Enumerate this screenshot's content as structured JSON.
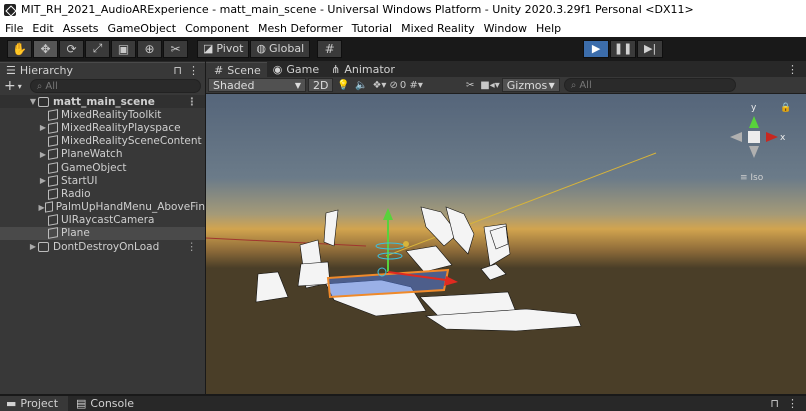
{
  "window": {
    "title": "MIT_RH_2021_AudioARExperience - matt_main_scene - Universal Windows Platform - Unity 2020.3.29f1 Personal <DX11>"
  },
  "menu": [
    "File",
    "Edit",
    "Assets",
    "GameObject",
    "Component",
    "Mesh Deformer",
    "Tutorial",
    "Mixed Reality",
    "Window",
    "Help"
  ],
  "toolbar": {
    "pivot": "Pivot",
    "global": "Global"
  },
  "hierarchy": {
    "tab": "Hierarchy",
    "search_placeholder": "All",
    "add_label": "+",
    "scene": "matt_main_scene",
    "items": [
      {
        "label": "MixedRealityToolkit",
        "expandable": false
      },
      {
        "label": "MixedRealityPlayspace",
        "expandable": true
      },
      {
        "label": "MixedRealitySceneContent",
        "expandable": false
      },
      {
        "label": "PlaneWatch",
        "expandable": true
      },
      {
        "label": "GameObject",
        "expandable": false
      },
      {
        "label": "StartUI",
        "expandable": true
      },
      {
        "label": "Radio",
        "expandable": false
      },
      {
        "label": "PalmUpHandMenu_AboveFin",
        "expandable": true
      },
      {
        "label": "UIRaycastCamera",
        "expandable": false
      },
      {
        "label": "Plane",
        "expandable": false
      }
    ],
    "dont_destroy": "DontDestroyOnLoad"
  },
  "scene_tabs": {
    "scene": "Scene",
    "game": "Game",
    "animator": "Animator"
  },
  "scene_toolbar": {
    "shading": "Shaded",
    "twod": "2D",
    "hidden_count": "0",
    "gizmos": "Gizmos",
    "search_placeholder": "All"
  },
  "gizmo": {
    "y": "y",
    "x": "x",
    "iso": "Iso"
  },
  "bottom_tabs": {
    "project": "Project",
    "console": "Console"
  }
}
